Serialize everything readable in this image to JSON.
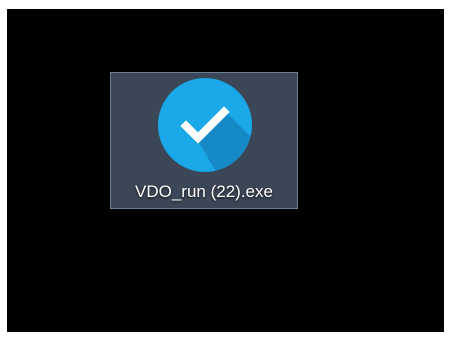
{
  "desktop": {
    "background_color": "#000000",
    "icons": [
      {
        "label": "VDO_run (22).exe",
        "icon": "checkmark-circle-icon",
        "selected": true,
        "icon_color": "#1aa8e8",
        "selection_color": "#3b4656"
      }
    ]
  }
}
